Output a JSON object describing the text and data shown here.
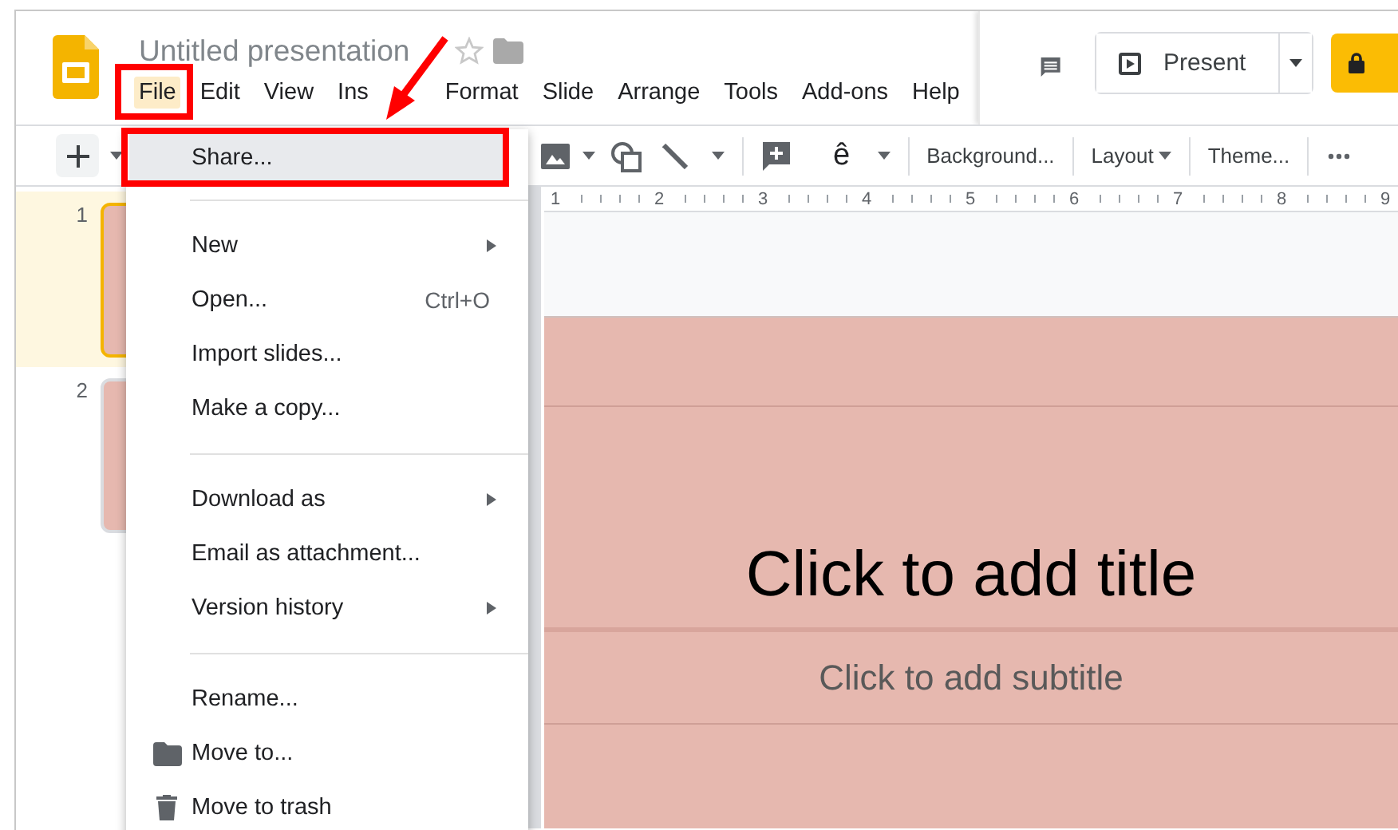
{
  "app": {
    "title": "Untitled presentation"
  },
  "menu_bar": [
    {
      "label": "File",
      "selected": true
    },
    {
      "label": "Edit",
      "selected": false
    },
    {
      "label": "View",
      "selected": false
    },
    {
      "label": "Ins",
      "selected": false
    },
    {
      "label": "Format",
      "selected": false
    },
    {
      "label": "Slide",
      "selected": false
    },
    {
      "label": "Arrange",
      "selected": false
    },
    {
      "label": "Tools",
      "selected": false
    },
    {
      "label": "Add-ons",
      "selected": false
    },
    {
      "label": "Help",
      "selected": false
    }
  ],
  "header": {
    "present_label": "Present"
  },
  "toolbar": {
    "glyph": "ê",
    "buttons": [
      {
        "label": "Background...",
        "kind": "plain"
      },
      {
        "label": "Layout",
        "kind": "dropdown"
      },
      {
        "label": "Theme...",
        "kind": "plain"
      }
    ]
  },
  "ruler": [
    "1",
    "2",
    "3",
    "4",
    "5",
    "6",
    "7",
    "8",
    "9"
  ],
  "slides": [
    {
      "number": "1",
      "selected": true
    },
    {
      "number": "2",
      "selected": false
    }
  ],
  "slide": {
    "title": "Click to add title",
    "subtitle": "Click to add subtitle"
  },
  "file_menu": {
    "items": [
      {
        "kind": "item",
        "label": "Share...",
        "highlighted": true
      },
      {
        "kind": "separator"
      },
      {
        "kind": "submenu",
        "label": "New",
        "highlighted": false
      },
      {
        "kind": "item",
        "label": "Open...",
        "shortcut": "Ctrl+O",
        "highlighted": false
      },
      {
        "kind": "item",
        "label": "Import slides...",
        "highlighted": false
      },
      {
        "kind": "item",
        "label": "Make a copy...",
        "highlighted": false
      },
      {
        "kind": "separator"
      },
      {
        "kind": "submenu",
        "label": "Download as",
        "highlighted": false
      },
      {
        "kind": "item",
        "label": "Email as attachment...",
        "highlighted": false
      },
      {
        "kind": "submenu",
        "label": "Version history",
        "highlighted": false
      },
      {
        "kind": "separator"
      },
      {
        "kind": "item",
        "label": "Rename...",
        "highlighted": false
      },
      {
        "kind": "folder",
        "label": "Move to...",
        "highlighted": false
      },
      {
        "kind": "trash",
        "label": "Move to trash",
        "highlighted": false
      }
    ]
  }
}
